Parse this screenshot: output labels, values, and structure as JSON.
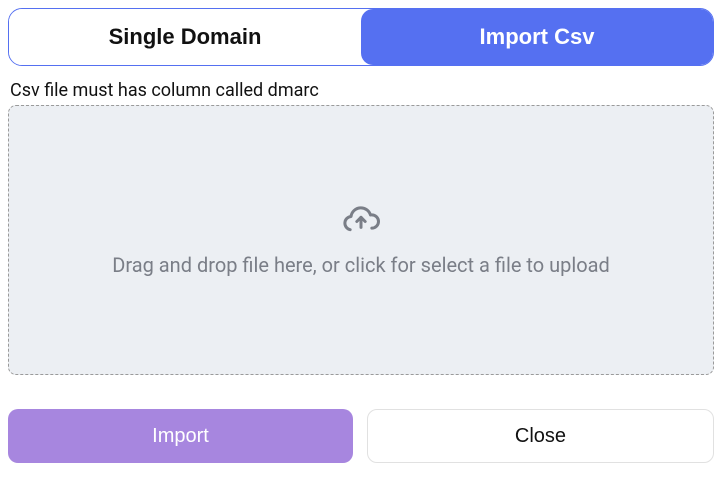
{
  "tabs": {
    "single_domain_label": "Single Domain",
    "import_csv_label": "Import Csv"
  },
  "hint_text": "Csv file must has column called dmarc",
  "dropzone": {
    "instruction": "Drag and drop file here, or click for select a file to upload",
    "icon_name": "cloud-upload"
  },
  "buttons": {
    "import_label": "Import",
    "close_label": "Close"
  },
  "colors": {
    "tab_active_bg": "#5570F1",
    "dropzone_bg": "#ECEFF3",
    "primary_btn_bg": "#A786DF"
  }
}
